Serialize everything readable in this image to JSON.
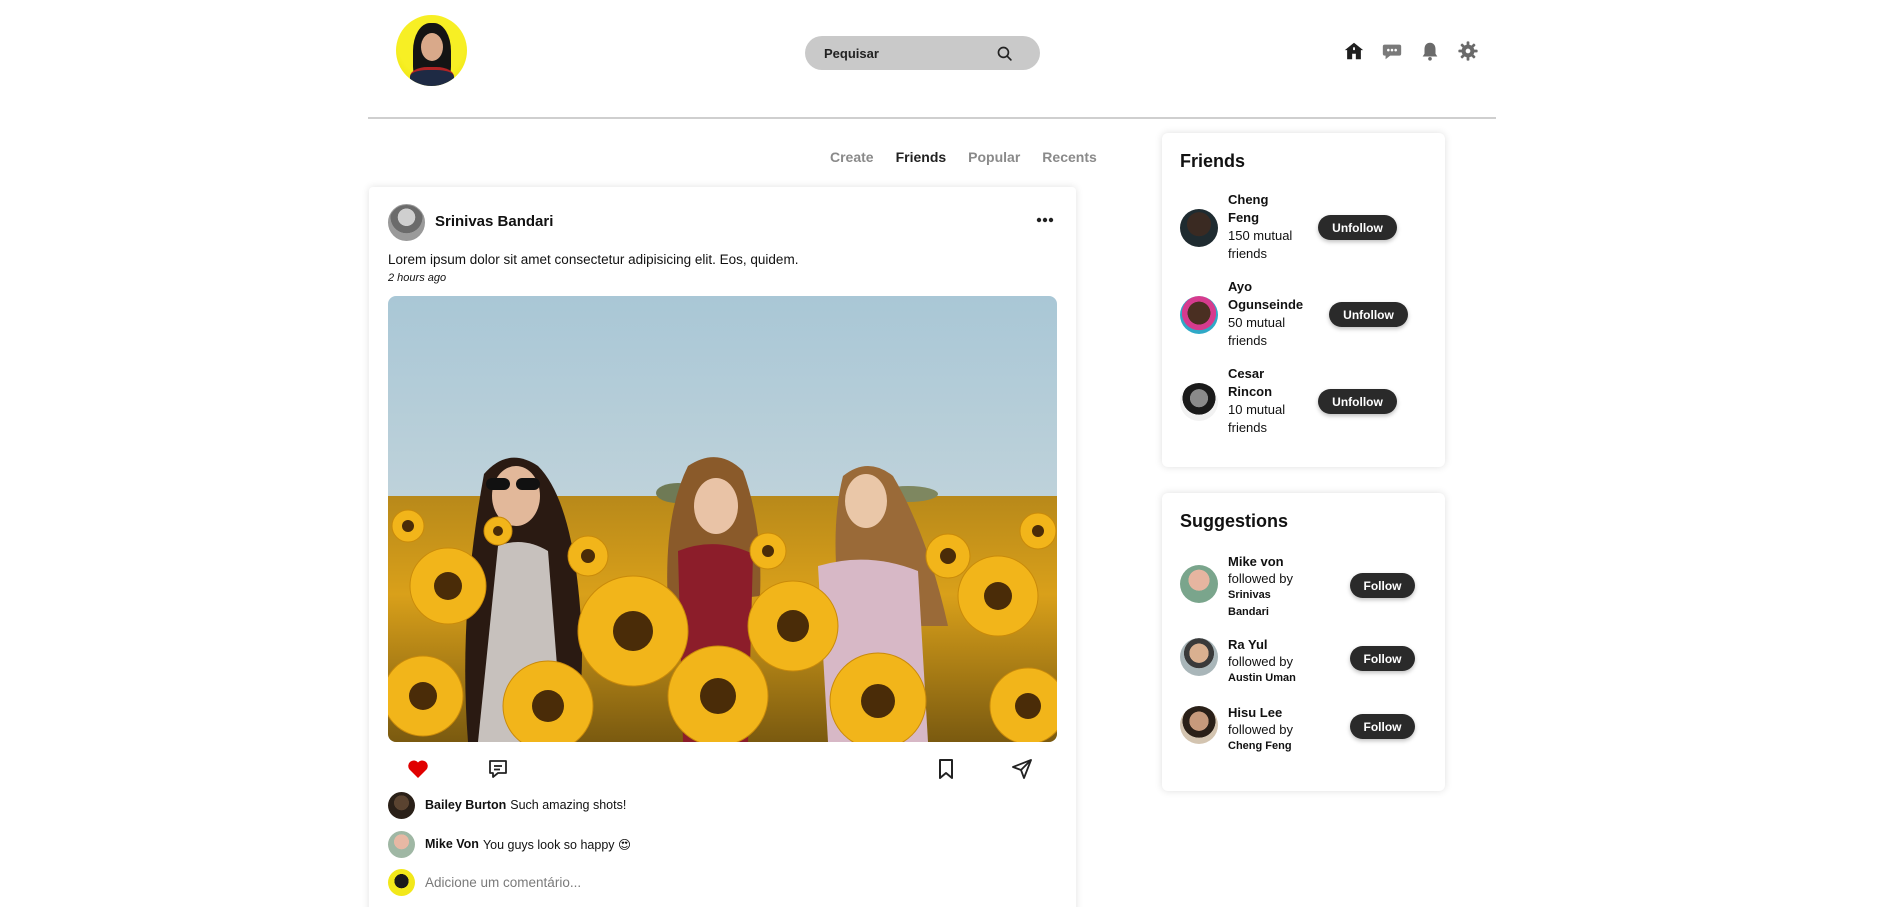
{
  "search": {
    "placeholder": "Pequisar"
  },
  "header": {
    "icons": [
      "home-icon",
      "chat-icon",
      "bell-icon",
      "settings-icon"
    ]
  },
  "tabs": [
    {
      "label": "Create",
      "active": false
    },
    {
      "label": "Friends",
      "active": true
    },
    {
      "label": "Popular",
      "active": false
    },
    {
      "label": "Recents",
      "active": false
    }
  ],
  "post": {
    "author": "Srinivas Bandari",
    "text": "Lorem ipsum dolor sit amet consectetur adipisicing elit. Eos, quidem.",
    "time": "2 hours ago",
    "liked": true,
    "comments": [
      {
        "name": "Bailey Burton",
        "text": "Such amazing shots!"
      },
      {
        "name": "Mike Von",
        "text": "You guys look so happy 😍"
      }
    ],
    "comment_placeholder": "Adicione um comentário..."
  },
  "friends": {
    "title": "Friends",
    "items": [
      {
        "name_line1": "Cheng",
        "name_line2": "Feng",
        "mutual_line1": "150 mutual",
        "mutual_line2": "friends",
        "button": "Unfollow"
      },
      {
        "name_line1": "Ayo",
        "name_line2": "Ogunseinde",
        "mutual_line1": "50 mutual",
        "mutual_line2": "friends",
        "button": "Unfollow"
      },
      {
        "name_line1": "Cesar",
        "name_line2": "Rincon",
        "mutual_line1": "10 mutual",
        "mutual_line2": "friends",
        "button": "Unfollow"
      }
    ]
  },
  "suggestions": {
    "title": "Suggestions",
    "items": [
      {
        "name": "Mike von",
        "followed_by": "followed by",
        "by_line1": "Srinivas",
        "by_line2": "Bandari",
        "button": "Follow"
      },
      {
        "name": "Ra Yul",
        "followed_by": "followed by",
        "by_line1": "Austin Uman",
        "by_line2": "",
        "button": "Follow"
      },
      {
        "name": "Hisu Lee",
        "followed_by": "followed by",
        "by_line1": "Cheng Feng",
        "by_line2": "",
        "button": "Follow"
      }
    ]
  },
  "colors": {
    "accent": "#2a2a2a",
    "like": "#e00000",
    "search_bg": "#c9c9c9",
    "profile_ring": "#f7ef24"
  }
}
